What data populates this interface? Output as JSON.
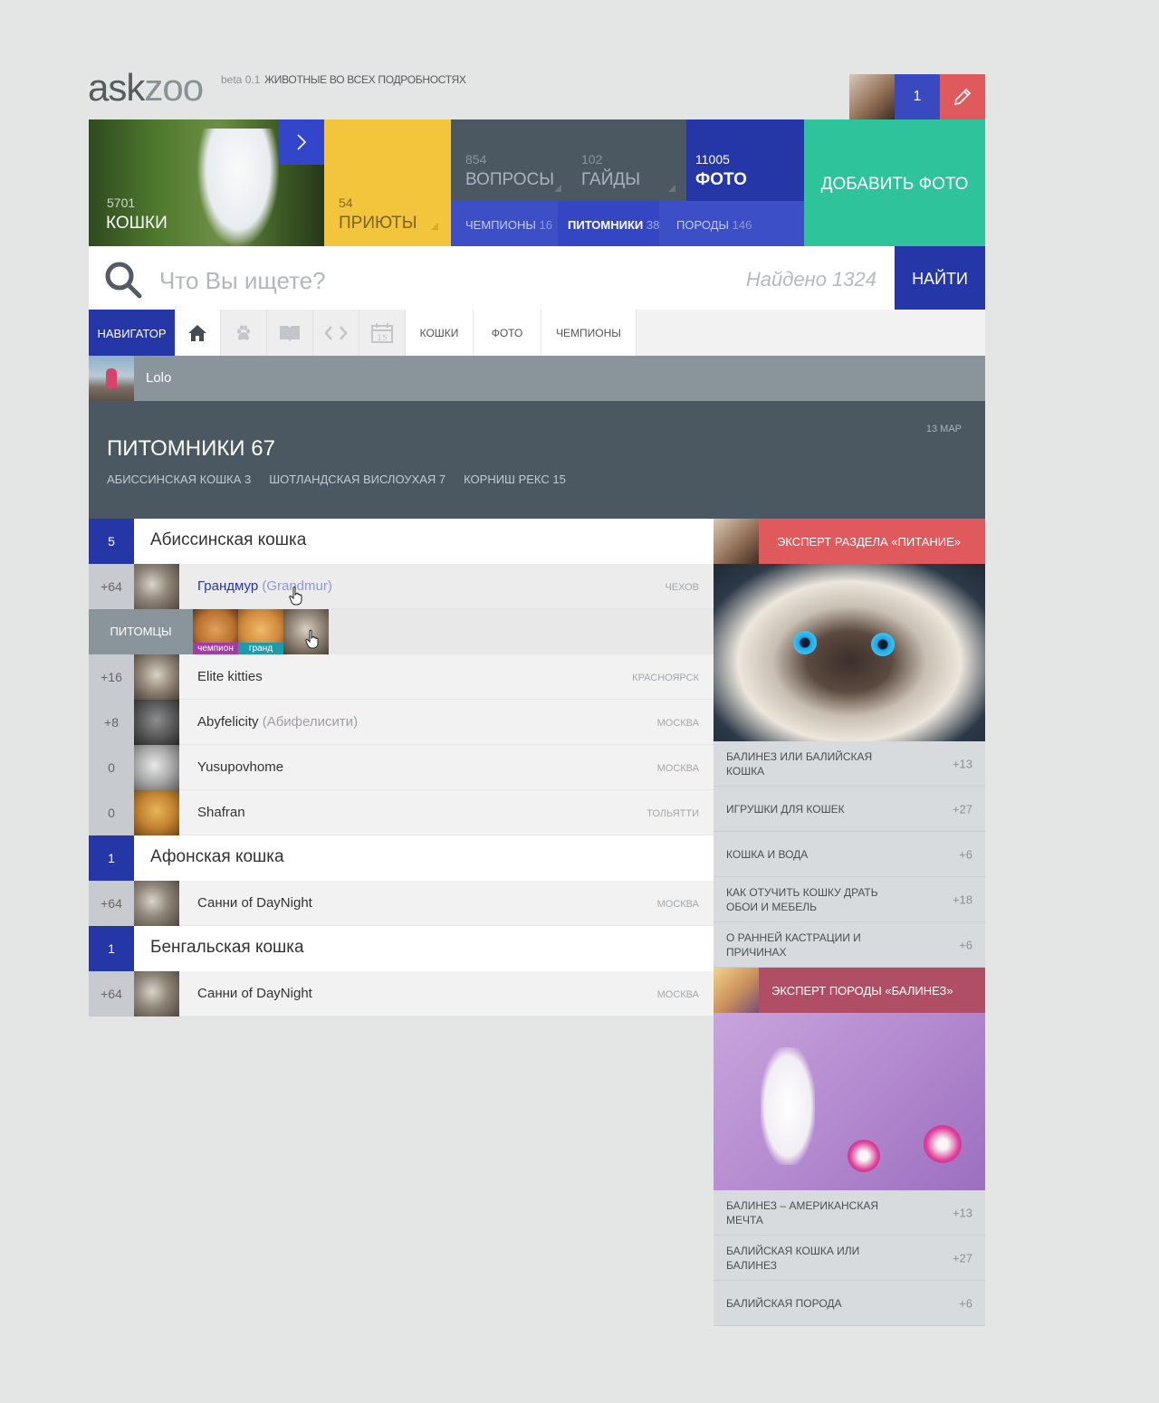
{
  "header": {
    "logo_ask": "ask",
    "logo_zoo": "zoo",
    "beta": "beta 0.1",
    "tagline": "ЖИВОТНЫЕ ВО ВСЕХ ПОДРОБНОСТЯХ",
    "user_count": "1"
  },
  "tiles": {
    "cats": {
      "num": "5701",
      "label": "КОШКИ"
    },
    "shelters": {
      "num": "54",
      "label": "ПРИЮТЫ"
    },
    "questions": {
      "num": "854",
      "label": "ВОПРОСЫ"
    },
    "guides": {
      "num": "102",
      "label": "ГАЙДЫ"
    },
    "photo": {
      "num": "11005",
      "label": "ФОТО"
    },
    "champions": {
      "label": "ЧЕМПИОНЫ",
      "num": "16"
    },
    "nurseries": {
      "label": "ПИТОМНИКИ",
      "num": "38"
    },
    "breeds": {
      "label": "ПОРОДЫ",
      "num": "146"
    },
    "add_photo": "ДОБАВИТЬ ФОТО"
  },
  "search": {
    "placeholder": "Что Вы ищете?",
    "found": "Найдено 1324",
    "button": "НАЙТИ"
  },
  "nav": {
    "label": "НАВИГАТОР",
    "calendar_day": "15",
    "tabs": [
      "КОШКИ",
      "ФОТО",
      "ЧЕМПИОНЫ"
    ]
  },
  "user": {
    "name": "Lolo"
  },
  "section": {
    "date": "13 МАР",
    "title": "ПИТОМНИКИ 67",
    "tags": [
      "АБИССИНСКАЯ КОШКА  3",
      "ШОТЛАНДСКАЯ ВИСЛОУХАЯ  7",
      "КОРНИШ РЕКС 15"
    ]
  },
  "groups": [
    {
      "count": "5",
      "name": "Абиссинская кошка",
      "rows": [
        {
          "score": "+64",
          "title": "Грандмур",
          "alt": "(Grandmur)",
          "city": "ЧЕХОВ"
        },
        {
          "score": "+16",
          "title": "Elite kitties",
          "alt": "",
          "city": "КРАСНОЯРСК"
        },
        {
          "score": "+8",
          "title": "Abyfelicity",
          "alt": "(Абифелисити)",
          "city": "МОСКВА"
        },
        {
          "score": "0",
          "title": "Yusupovhome",
          "alt": "",
          "city": "МОСКВА"
        },
        {
          "score": "0",
          "title": "Shafran",
          "alt": "",
          "city": "ТОЛЬЯТТИ"
        }
      ]
    },
    {
      "count": "1",
      "name": "Афонская кошка",
      "rows": [
        {
          "score": "+64",
          "title": "Санни of DayNight",
          "city": "МОСКВА"
        }
      ]
    },
    {
      "count": "1",
      "name": "Бенгальская кошка",
      "rows": [
        {
          "score": "+64",
          "title": "Санни of DayNight",
          "city": "МОСКВА"
        }
      ]
    }
  ],
  "pets": {
    "label": "ПИТОМЦЫ",
    "badges": [
      "чемпион",
      "гранд"
    ],
    "badge_colors": [
      "#a13ca0",
      "#1f9aa8"
    ]
  },
  "sidebar": {
    "expert1": {
      "title": "ЭКСПЕРТ РАЗДЕЛА «ПИТАНИЕ»",
      "color": "#e05a5d"
    },
    "list1": [
      {
        "title": "БАЛИНЕЗ ИЛИ БАЛИЙСКАЯ КОШКА",
        "value": "+13"
      },
      {
        "title": "ИГРУШКИ ДЛЯ КОШЕК",
        "value": "+27"
      },
      {
        "title": "КОШКА И ВОДА",
        "value": "+6"
      },
      {
        "title": "КАК ОТУЧИТЬ КОШКУ ДРАТЬ ОБОИ И МЕБЕЛЬ",
        "value": "+18"
      },
      {
        "title": "О РАННЕЙ КАСТРАЦИИ И ПРИЧИНАХ",
        "value": "+6"
      }
    ],
    "expert2": {
      "title": "ЭКСПЕРТ ПОРОДЫ «БАЛИНЕЗ»",
      "color": "#b04e66"
    },
    "list2": [
      {
        "title": "БАЛИНЕЗ – АМЕРИКАНСКАЯ МЕЧТА",
        "value": "+13"
      },
      {
        "title": "БАЛИЙСКАЯ КОШКА ИЛИ БАЛИНЕЗ",
        "value": "+27"
      },
      {
        "title": "БАЛИЙСКАЯ ПОРОДА",
        "value": "+6"
      }
    ]
  }
}
